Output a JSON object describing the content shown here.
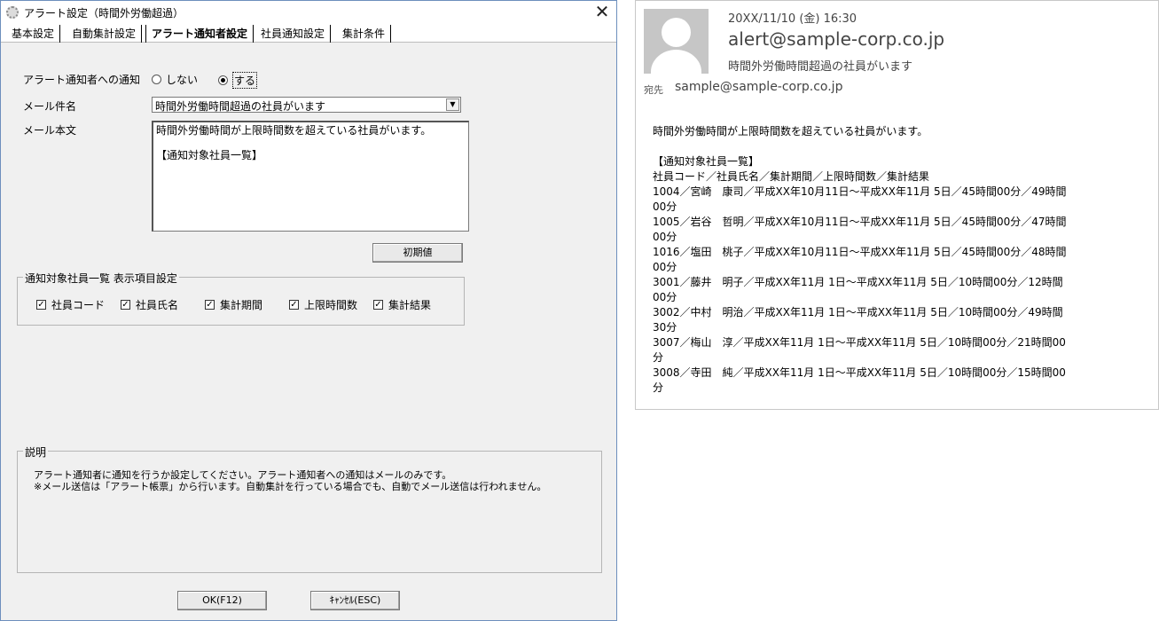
{
  "dialog": {
    "title": "アラート設定（時間外労働超過）",
    "close_glyph": "✕",
    "tabs": [
      {
        "label": "基本設定"
      },
      {
        "label": "自動集計設定"
      },
      {
        "label": "アラート通知者設定"
      },
      {
        "label": "社員通知設定"
      },
      {
        "label": "集計条件"
      }
    ],
    "notify": {
      "label": "アラート通知者への通知",
      "option_off": "しない",
      "option_on": "する",
      "selected": "する"
    },
    "subject": {
      "label": "メール件名",
      "value": "時間外労働時間超過の社員がいます"
    },
    "body": {
      "label": "メール本文",
      "value": "時間外労働時間が上限時間数を超えている社員がいます。\n\n【通知対象社員一覧】"
    },
    "reset_button": "初期値",
    "display_group": {
      "title": "通知対象社員一覧 表示項目設定",
      "items": [
        {
          "label": "社員コード",
          "checked": true
        },
        {
          "label": "社員氏名",
          "checked": true
        },
        {
          "label": "集計期間",
          "checked": true
        },
        {
          "label": "上限時間数",
          "checked": true
        },
        {
          "label": "集計結果",
          "checked": true
        }
      ]
    },
    "description": {
      "title": "説明",
      "line1": "アラート通知者に通知を行うか設定してください。アラート通知者への通知はメールのみです。",
      "line2": "※メール送信は「アラート帳票」から行います。自動集計を行っている場合でも、自動でメール送信は行われません。"
    },
    "ok_button": "OK(F12)",
    "cancel_button": "ｷｬﾝｾﾙ(ESC)"
  },
  "mail": {
    "date": "20XX/11/10 (金) 16:30",
    "from": "alert@sample-corp.co.jp",
    "subject": "時間外労働時間超過の社員がいます",
    "to_label": "宛先",
    "to": "sample@sample-corp.co.jp",
    "body_lines": [
      "時間外労働時間が上限時間数を超えている社員がいます。",
      "",
      "【通知対象社員一覧】",
      "社員コード／社員氏名／集計期間／上限時間数／集計結果",
      "1004／宮崎　康司／平成XX年10月11日～平成XX年11月 5日／45時間00分／49時間",
      "00分",
      "1005／岩谷　哲明／平成XX年10月11日～平成XX年11月 5日／45時間00分／47時間",
      "00分",
      "1016／塩田　桃子／平成XX年10月11日～平成XX年11月 5日／45時間00分／48時間",
      "00分",
      "3001／藤井　明子／平成XX年11月 1日～平成XX年11月 5日／10時間00分／12時間",
      "00分",
      "3002／中村　明治／平成XX年11月 1日～平成XX年11月 5日／10時間00分／49時間",
      "30分",
      "3007／梅山　淳／平成XX年11月 1日～平成XX年11月 5日／10時間00分／21時間00",
      "分",
      "3008／寺田　純／平成XX年11月 1日～平成XX年11月 5日／10時間00分／15時間00",
      "分"
    ]
  }
}
